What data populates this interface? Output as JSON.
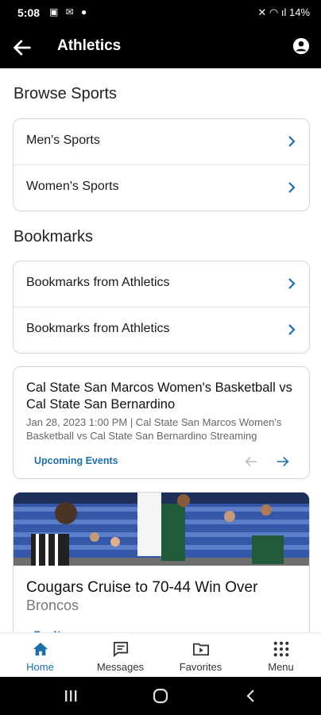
{
  "status_bar": {
    "time": "5:08",
    "left_icons": "▣ ✉ ●",
    "right_icons": "✕ ◠ ıl 14%"
  },
  "app_bar": {
    "title": "Athletics"
  },
  "browse": {
    "title": "Browse Sports",
    "items": [
      {
        "label": "Men's Sports"
      },
      {
        "label": "Women's Sports"
      }
    ]
  },
  "bookmarks": {
    "title": "Bookmarks",
    "items": [
      {
        "label": "Bookmarks from Athletics"
      },
      {
        "label": "Bookmarks from Athletics"
      }
    ]
  },
  "event_card": {
    "title": "Cal State San Marcos Women's Basketball vs Cal State San Bernardino",
    "description": "Jan 28, 2023 1:00 PM | Cal State San Marcos Women's Basketball vs Cal State San Bernardino Streaming",
    "link": "Upcoming Events"
  },
  "news_card": {
    "title": "Cougars Cruise to 70-44 Win Over",
    "subtitle": "Broncos",
    "link": "Top News"
  },
  "tabs": [
    {
      "label": "Home",
      "icon": "home-icon",
      "active": true
    },
    {
      "label": "Messages",
      "icon": "messages-icon",
      "active": false
    },
    {
      "label": "Favorites",
      "icon": "favorites-icon",
      "active": false
    },
    {
      "label": "Menu",
      "icon": "menu-grid-icon",
      "active": false
    }
  ],
  "colors": {
    "accent": "#1d6fa8",
    "header_bg": "#000000",
    "border": "#d6d6d6"
  }
}
